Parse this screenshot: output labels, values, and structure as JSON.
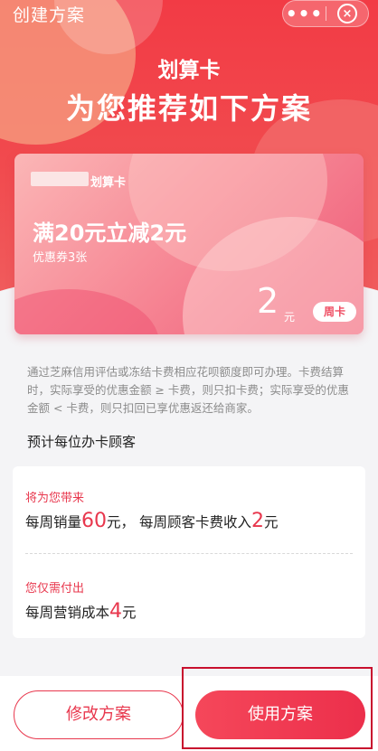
{
  "header": {
    "title": "创建方案",
    "more_label": "•••",
    "close_label": "×"
  },
  "hero": {
    "brand": "划算卡",
    "headline": "为您推荐如下方案"
  },
  "card": {
    "name": "划算卡",
    "offer": "满20元立减2元",
    "coupon": "优惠券3张",
    "price": "2",
    "price_unit": "元",
    "period": "周卡"
  },
  "description": "通过芝麻信用评估或冻结卡费相应花呗额度即可办理。卡费结算时，实际享受的优惠金额 ≥ 卡费，则只扣卡费；实际享受的优惠金额 < 卡费，则只扣回已享优惠返还给商家。",
  "estimate": {
    "title": "预计每位办卡顾客",
    "bring": {
      "label": "将为您带来",
      "sales_prefix": "每周销量",
      "sales_value": "60",
      "sales_suffix": "元，",
      "fee_prefix": "每周顾客卡费收入",
      "fee_value": "2",
      "fee_suffix": "元"
    },
    "pay": {
      "label": "您仅需付出",
      "cost_prefix": "每周营销成本",
      "cost_value": "4",
      "cost_suffix": "元"
    }
  },
  "actions": {
    "modify_label": "修改方案",
    "use_label": "使用方案"
  },
  "colors": {
    "brand_red": "#e8374d",
    "hero_red": "#f23b45"
  }
}
